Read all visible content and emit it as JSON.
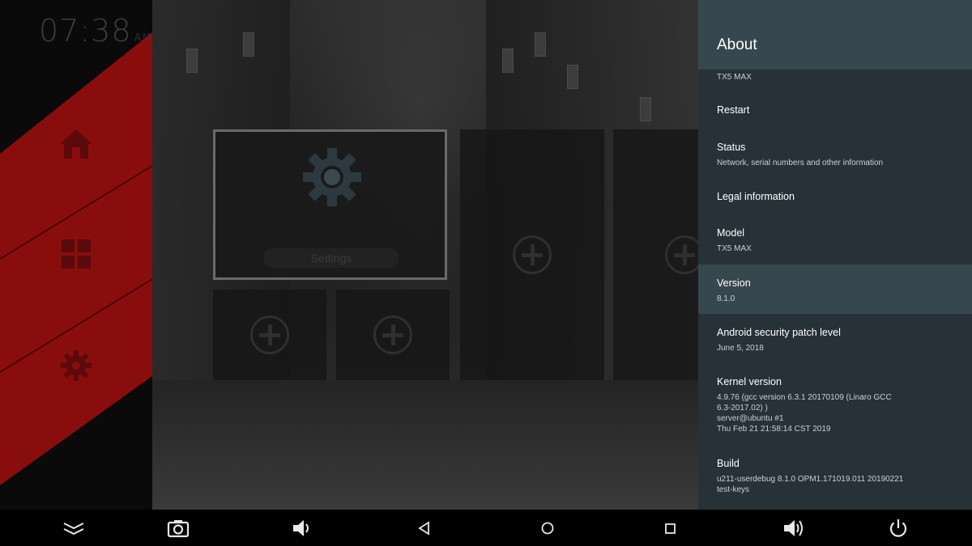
{
  "clock": {
    "time": "07:38",
    "ampm": "AM"
  },
  "sidebar": {
    "items": [
      {
        "icon": "home-icon"
      },
      {
        "icon": "apps-grid-icon"
      },
      {
        "icon": "gear-icon"
      }
    ]
  },
  "tiles": {
    "settings_label": "Settings"
  },
  "panel": {
    "title": "About",
    "device_name": "TX5 MAX",
    "items": [
      {
        "title": "Restart",
        "subtitle": ""
      },
      {
        "title": "Status",
        "subtitle": "Network, serial numbers and other information"
      },
      {
        "title": "Legal information",
        "subtitle": ""
      },
      {
        "title": "Model",
        "subtitle": "TX5 MAX"
      },
      {
        "title": "Version",
        "subtitle": "8.1.0"
      },
      {
        "title": "Android security patch level",
        "subtitle": "June 5, 2018"
      },
      {
        "title": "Kernel version",
        "subtitle": "4.9.76 (gcc version 6.3.1 20170109 (Linaro GCC\n6.3-2017.02) )\nserver@ubuntu #1\nThu Feb 21 21:58:14 CST 2019"
      },
      {
        "title": "Build",
        "subtitle": "u211-userdebug 8.1.0 OPM1.171019.011 20190221\ntest-keys"
      }
    ],
    "colors": {
      "background": "#263238",
      "header": "#37474f",
      "highlight": "#37474f"
    }
  },
  "navbar": {
    "buttons": [
      {
        "icon": "collapse-chevrons-icon"
      },
      {
        "icon": "camera-icon"
      },
      {
        "icon": "volume-down-icon"
      },
      {
        "icon": "back-triangle-icon"
      },
      {
        "icon": "home-circle-icon"
      },
      {
        "icon": "recents-square-icon"
      },
      {
        "icon": "volume-up-icon"
      },
      {
        "icon": "power-icon"
      }
    ]
  }
}
